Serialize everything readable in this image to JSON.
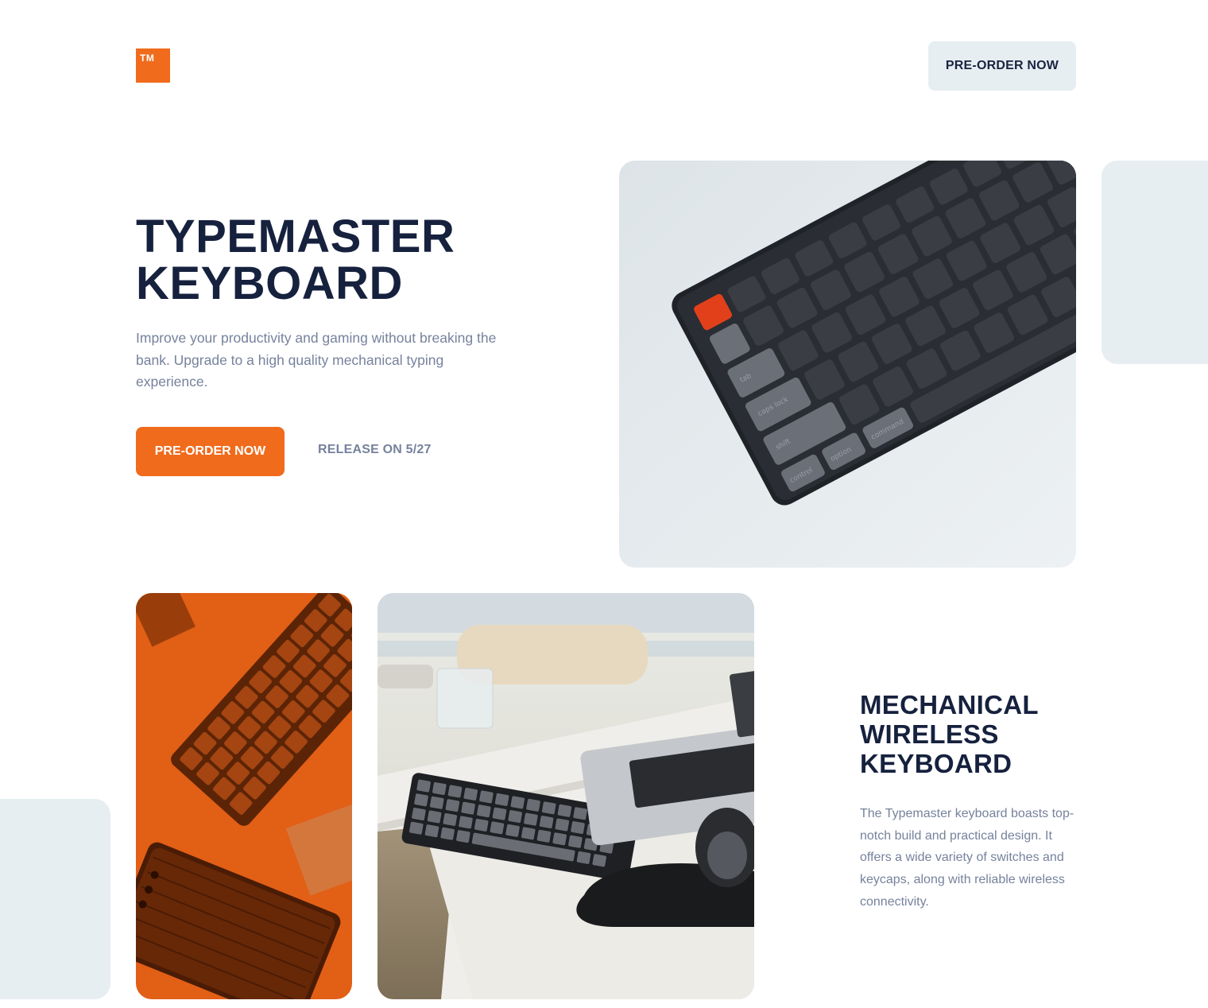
{
  "brand": {
    "logo_text": "TM",
    "accent": "#f06b1c"
  },
  "header": {
    "preorder_label": "PRE-ORDER NOW"
  },
  "hero": {
    "title_line1": "TYPEMASTER",
    "title_line2": "KEYBOARD",
    "description": "Improve your productivity and gaming without breaking the bank. Upgrade to a high quality mechanical typing experience.",
    "preorder_label": "PRE-ORDER NOW",
    "release_label": "RELEASE ON 5/27"
  },
  "feature": {
    "title_line1": "MECHANICAL",
    "title_line2": "WIRELESS",
    "title_line3": "KEYBOARD",
    "description": "The Typemaster keyboard boasts top-notch build and practical design. It offers a wide variety of switches and keycaps, along with reliable wireless connectivity."
  },
  "images": {
    "hero": "keyboard-closeup-photo",
    "left": "orange-tinted-keyboard-photo",
    "right": "desk-setup-photo"
  }
}
